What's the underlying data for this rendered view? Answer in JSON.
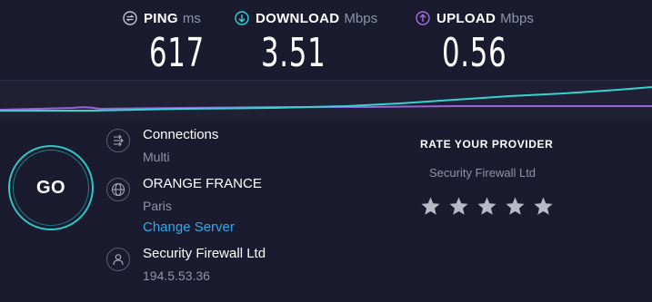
{
  "metrics": {
    "ping": {
      "label": "PING",
      "unit": "ms",
      "value": "617",
      "icon": "ping-icon",
      "color": "#c3c4d4"
    },
    "download": {
      "label": "DOWNLOAD",
      "unit": "Mbps",
      "value": "3.51",
      "icon": "download-arrow-icon",
      "color": "#2fd5d5"
    },
    "upload": {
      "label": "UPLOAD",
      "unit": "Mbps",
      "value": "0.56",
      "icon": "upload-arrow-icon",
      "color": "#a56ee3"
    }
  },
  "go_button": {
    "label": "GO"
  },
  "connections": {
    "title": "Connections",
    "value": "Multi",
    "icon": "connections-icon"
  },
  "server": {
    "title": "ORANGE FRANCE",
    "location": "Paris",
    "change_link": "Change Server",
    "icon": "globe-icon"
  },
  "isp": {
    "name": "Security Firewall Ltd",
    "ip": "194.5.53.36",
    "icon": "user-icon"
  },
  "rating": {
    "title": "RATE YOUR PROVIDER",
    "provider": "Security Firewall Ltd",
    "max_stars": 5,
    "selected_stars": 0
  },
  "colors": {
    "background": "#1a1b2e",
    "accent_cyan": "#2fd5d5",
    "accent_purple": "#a56ee3",
    "link": "#2fa9e8",
    "muted_text": "#9193a8",
    "star_empty": "#b8b9c6"
  }
}
